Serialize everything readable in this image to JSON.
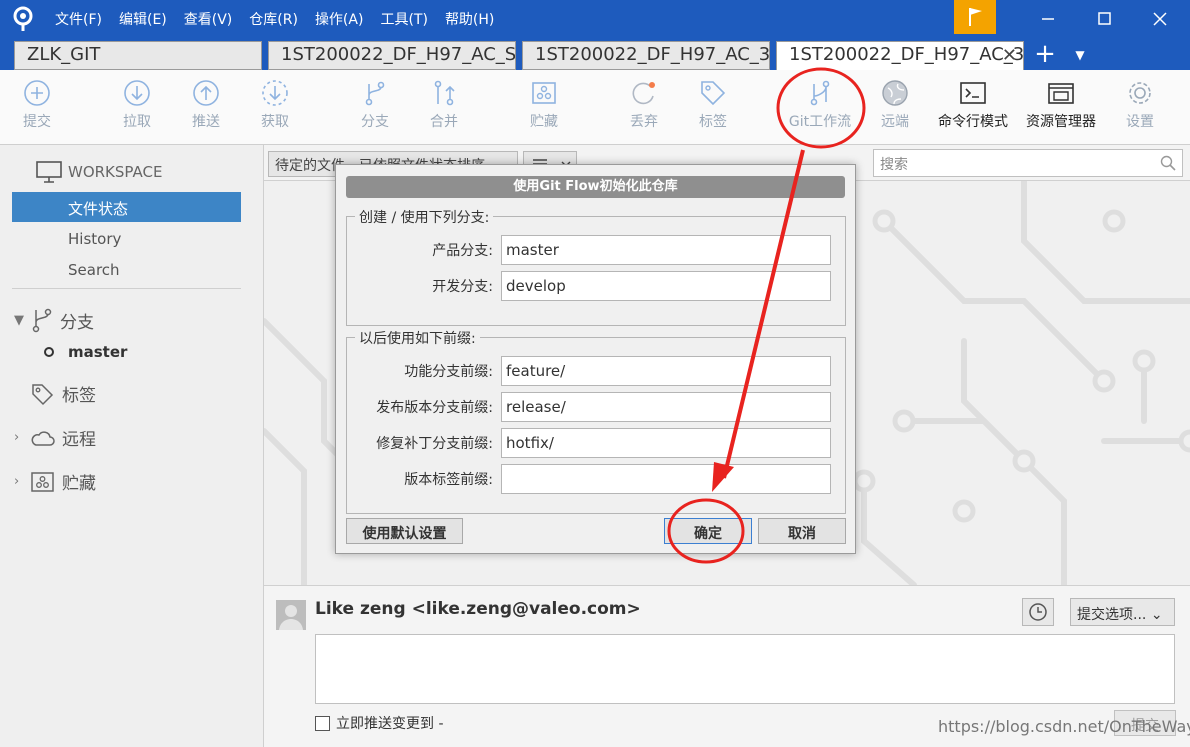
{
  "menu": {
    "items": [
      "文件(F)",
      "编辑(E)",
      "查看(V)",
      "仓库(R)",
      "操作(A)",
      "工具(T)",
      "帮助(H)"
    ]
  },
  "tabs": [
    {
      "label": "ZLK_GIT"
    },
    {
      "label": "1ST200022_DF_H97_AC_S"
    },
    {
      "label": "1ST200022_DF_H97_AC_3"
    },
    {
      "label": "1ST200022_DF_H97_AC_3"
    }
  ],
  "toolbar": {
    "commit": "提交",
    "pull": "拉取",
    "push": "推送",
    "fetch": "获取",
    "branch": "分支",
    "merge": "合并",
    "stash": "贮藏",
    "discard": "丢弃",
    "tag": "标签",
    "gitflow": "Git工作流",
    "remote": "远端",
    "terminal": "命令行模式",
    "explorer": "资源管理器",
    "settings": "设置"
  },
  "sidebar": {
    "workspace": "WORKSPACE",
    "file_status": "文件状态",
    "history": "History",
    "search": "Search",
    "branches": "分支",
    "master": "master",
    "tags": "标签",
    "remotes": "远程",
    "stashes": "贮藏"
  },
  "main": {
    "filter": "待定的文件，已依照文件状态排序",
    "search_placeholder": "搜索"
  },
  "dialog": {
    "title": "使用Git Flow初始化此仓库",
    "group_branches": "创建 / 使用下列分支:",
    "production_label": "产品分支:",
    "production_value": "master",
    "develop_label": "开发分支:",
    "develop_value": "develop",
    "group_prefixes": "以后使用如下前缀:",
    "feature_label": "功能分支前缀:",
    "feature_value": "feature/",
    "release_label": "发布版本分支前缀:",
    "release_value": "release/",
    "hotfix_label": "修复补丁分支前缀:",
    "hotfix_value": "hotfix/",
    "version_label": "版本标签前缀:",
    "version_value": "",
    "defaults_button": "使用默认设置",
    "ok_button": "确定",
    "cancel_button": "取消"
  },
  "commit": {
    "author": "Like zeng <like.zeng@valeo.com>",
    "options": "提交选项...",
    "push_now": "立即推送变更到 -",
    "commit_button": "提交"
  },
  "watermark": "https://blog.csdn.net/OnTheWaykd",
  "colors": {
    "titlebar": "#1e5bbd",
    "selection": "#3d85c6",
    "flag": "#f4a300",
    "annotation": "#e8231f"
  }
}
